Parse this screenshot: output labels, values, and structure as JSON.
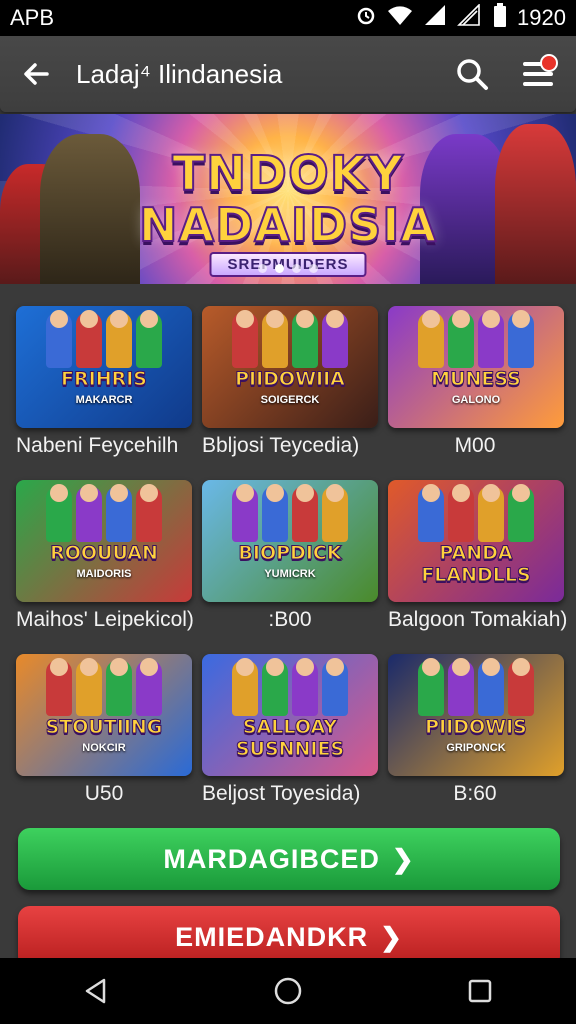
{
  "status_bar": {
    "carrier": "APB",
    "time": "1920"
  },
  "header": {
    "title": "Ladaj⁴ Ilindanesia"
  },
  "banner": {
    "headline_line1": "TNDOKY",
    "headline_line2": "NADAIDSIA",
    "ribbon": "SREPMUIDERS",
    "slide_count": 4,
    "active_slide": 2
  },
  "games": [
    {
      "thumb_title": "FRIHRIS",
      "thumb_sub": "MAKARCR",
      "caption": "Nabeni Feycehilh",
      "colors": [
        "#1e6fd6",
        "#103a8a"
      ]
    },
    {
      "thumb_title": "PIIDOWIIA",
      "thumb_sub": "SOIGERCK",
      "caption": "Bbljosi Teycedia)",
      "colors": [
        "#b85b2a",
        "#3a1e18"
      ]
    },
    {
      "thumb_title": "MUNESS",
      "thumb_sub": "GALONO",
      "caption": "M00",
      "colors": [
        "#8a3ac8",
        "#ff9c3a"
      ]
    },
    {
      "thumb_title": "ROOUUAN",
      "thumb_sub": "MAIDORIS",
      "caption": "Maihos' Leipekicol)",
      "colors": [
        "#2aa84a",
        "#c83a3a"
      ]
    },
    {
      "thumb_title": "BIOPDICK",
      "thumb_sub": "YUMICRK",
      "caption": ":B00",
      "colors": [
        "#6ab8e8",
        "#4a8a2a"
      ]
    },
    {
      "thumb_title": "PANDA FLANDLLS",
      "thumb_sub": "",
      "caption": "Balgoon Tomakiah)",
      "colors": [
        "#e05a2a",
        "#7a2a9a"
      ]
    },
    {
      "thumb_title": "STOUTIING",
      "thumb_sub": "NOKCIR",
      "caption": "U50",
      "colors": [
        "#e88a2a",
        "#2a6ad6"
      ]
    },
    {
      "thumb_title": "SALLOAY SUSNNIES",
      "thumb_sub": "",
      "caption": "Beljost Toyesida)",
      "colors": [
        "#3a6ae0",
        "#d85a8a"
      ]
    },
    {
      "thumb_title": "PIIDOWIS",
      "thumb_sub": "GRIPONCK",
      "caption": "B:60",
      "colors": [
        "#1a2a6a",
        "#e0a02a"
      ]
    }
  ],
  "buttons": {
    "primary": "MARDAGIBCED",
    "secondary": "EMIEDANDKR"
  }
}
